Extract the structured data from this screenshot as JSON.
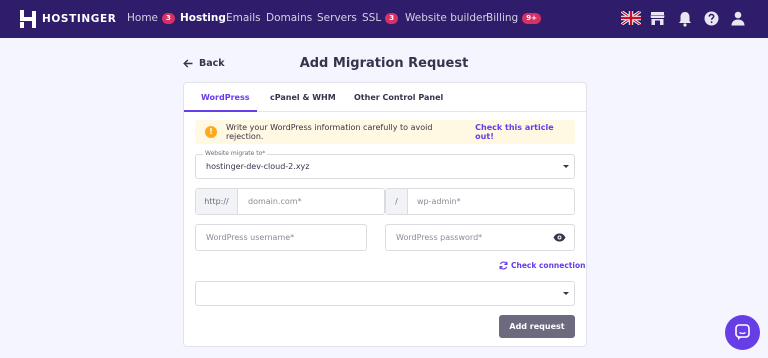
{
  "brand": {
    "name": "HOSTINGER"
  },
  "nav": {
    "items": [
      {
        "label": "Home",
        "badge": "3"
      },
      {
        "label": "Hosting",
        "badge": ""
      },
      {
        "label": "Emails",
        "badge": ""
      },
      {
        "label": "Domains",
        "badge": ""
      },
      {
        "label": "Servers",
        "badge": ""
      },
      {
        "label": "SSL",
        "badge": "3"
      },
      {
        "label": "Website builder",
        "badge": ""
      },
      {
        "label": "Billing",
        "badge": "9+"
      }
    ],
    "active": "Hosting",
    "icons": [
      "uk-flag-icon",
      "store-icon",
      "bell-icon",
      "help-icon",
      "user-icon"
    ]
  },
  "page": {
    "back_label": "Back",
    "title": "Add Migration Request"
  },
  "tabs": {
    "items": [
      {
        "label": "WordPress"
      },
      {
        "label": "cPanel & WHM"
      },
      {
        "label": "Other Control Panel"
      }
    ],
    "active": "WordPress"
  },
  "alert": {
    "icon": "!",
    "text": "Write your WordPress information carefully to avoid rejection.",
    "link": "Check this article out!"
  },
  "form": {
    "website": {
      "label": "Website migrate to*",
      "value": "hostinger-dev-cloud-2.xyz"
    },
    "url_prefix": "http://",
    "domain_placeholder": "domain.com*",
    "separator": "/",
    "path_placeholder": "wp-admin*",
    "username_placeholder": "WordPress username*",
    "password_placeholder": "WordPress password*",
    "check_connection": "Check connection",
    "extra_select_value": "",
    "submit": "Add request"
  },
  "colors": {
    "nav_bg": "#2f1c6a",
    "accent": "#673de6",
    "badge": "#d63163",
    "warning": "#ffaa1e",
    "button_disabled": "#6d6a80"
  }
}
